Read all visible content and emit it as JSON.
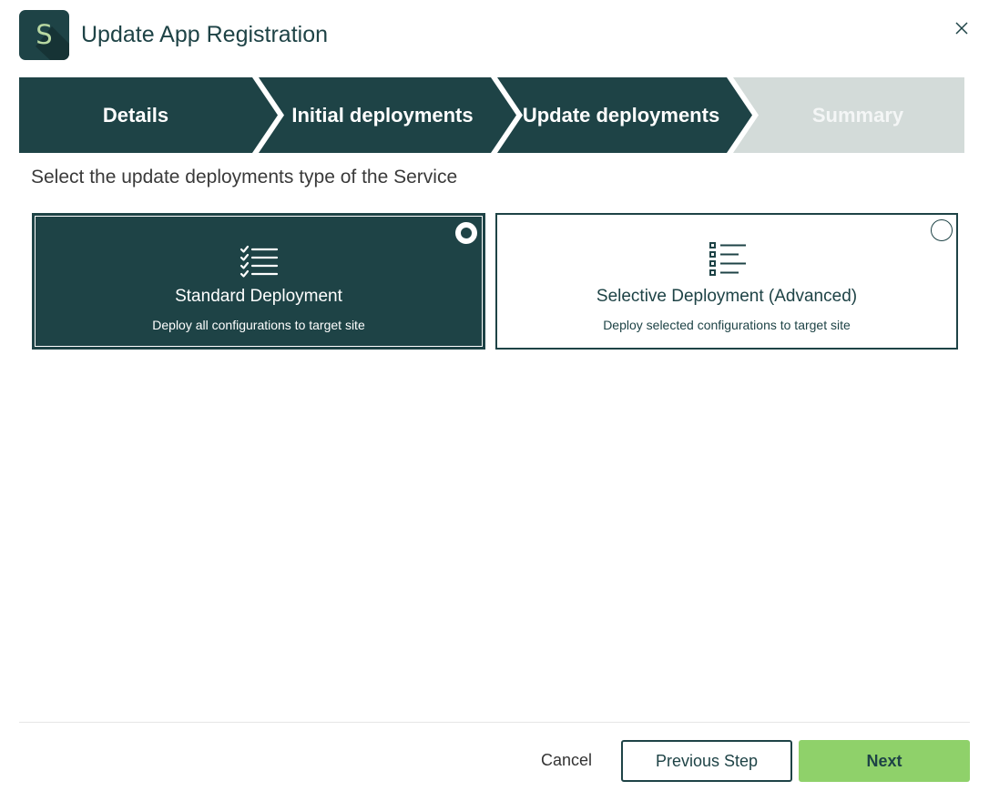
{
  "header": {
    "logo_letter": "S",
    "title": "Update App Registration",
    "close_icon": "close-icon"
  },
  "colors": {
    "primary": "#1e4346",
    "inactive_step": "#d3dbd9",
    "accent_green": "#8fd16a",
    "logo_letter": "#b8d8a2"
  },
  "stepper": {
    "steps": [
      {
        "label": "Details",
        "state": "complete"
      },
      {
        "label": "Initial deployments",
        "state": "complete"
      },
      {
        "label": "Update deployments",
        "state": "active"
      },
      {
        "label": "Summary",
        "state": "upcoming"
      }
    ]
  },
  "main": {
    "prompt": "Select the update deployments type of the Service",
    "options": [
      {
        "title": "Standard Deployment",
        "subtitle": "Deploy all configurations to target site",
        "icon": "checklist-icon",
        "selected": true
      },
      {
        "title": "Selective Deployment (Advanced)",
        "subtitle": "Deploy selected configurations to target site",
        "icon": "selective-list-icon",
        "selected": false
      }
    ]
  },
  "footer": {
    "cancel_label": "Cancel",
    "previous_label": "Previous Step",
    "next_label": "Next"
  }
}
